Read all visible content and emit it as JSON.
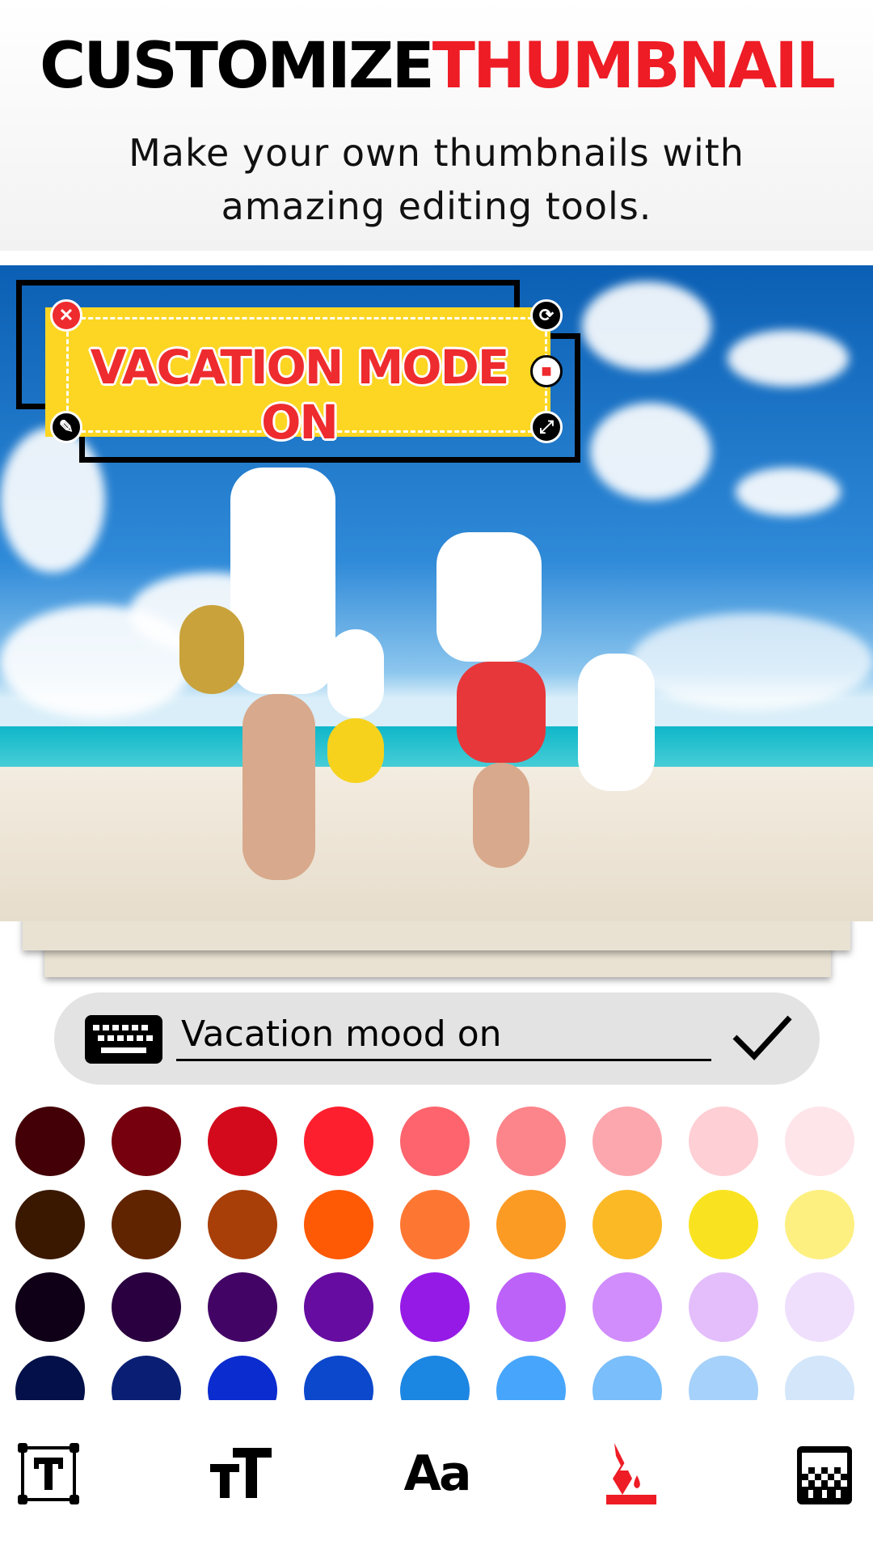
{
  "header": {
    "title_part1": "CUSTOMIZE",
    "title_part2": "THUMBNAIL",
    "subtitle_line1": "Make your own thumbnails with",
    "subtitle_line2": "amazing editing tools."
  },
  "banner": {
    "text": "VACATION MODE ON",
    "background": "#fcd623",
    "text_color": "#ee2b2e"
  },
  "text_input": {
    "value": "Vacation mood on"
  },
  "palette": [
    [
      "#430006",
      "#76000d",
      "#d20a1c",
      "#fe1f2e",
      "#fd646d",
      "#fc848b",
      "#fca7ae",
      "#fecfd4",
      "#fde5ea"
    ],
    [
      "#3a1800",
      "#612400",
      "#a83f08",
      "#fe5904",
      "#fd7733",
      "#fb9b23",
      "#fbb926",
      "#f9e321",
      "#fdf081"
    ],
    [
      "#0f0018",
      "#2a0040",
      "#430565",
      "#660ca1",
      "#951ae6",
      "#bd62f9",
      "#d18dfb",
      "#e3befb",
      "#efdffc"
    ],
    [
      "#03104a",
      "#0a1f74",
      "#0b2ccf",
      "#0c48cc",
      "#1c86e3",
      "#47a6fb",
      "#7abefb",
      "#a6d1fa",
      "#d3e6fa"
    ]
  ],
  "toolbar": {
    "items": [
      {
        "icon": "text-box-icon"
      },
      {
        "icon": "text-size-icon"
      },
      {
        "icon": "font-icon"
      },
      {
        "icon": "fill-color-icon",
        "active": true
      },
      {
        "icon": "opacity-pattern-icon"
      }
    ],
    "active_color": "#ee1c25"
  }
}
